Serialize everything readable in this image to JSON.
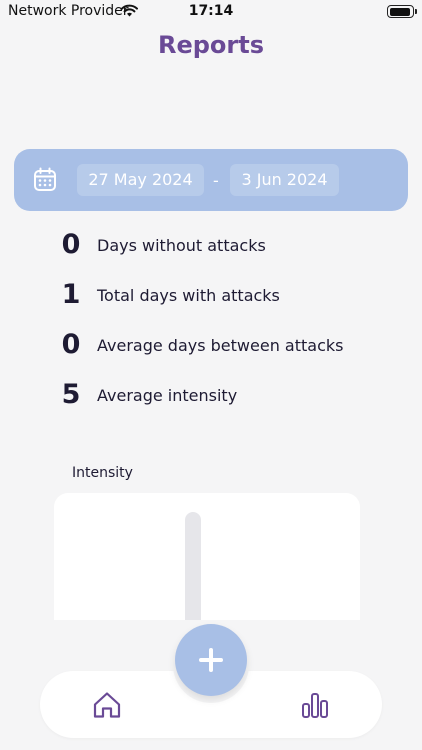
{
  "status_bar": {
    "carrier": "Network Provider",
    "time": "17:14"
  },
  "header": {
    "title": "Reports"
  },
  "date_range": {
    "start": "27 May 2024",
    "separator": "-",
    "end": "3 Jun 2024"
  },
  "stats": [
    {
      "value": "0",
      "label": "Days without attacks"
    },
    {
      "value": "1",
      "label": "Total days with attacks"
    },
    {
      "value": "0",
      "label": "Average days between attacks"
    },
    {
      "value": "5",
      "label": "Average intensity"
    }
  ],
  "intensity_section": {
    "label": "Intensity"
  },
  "nav": {
    "items": [
      {
        "icon": "home-icon"
      },
      {
        "icon": "bar-chart-icon"
      }
    ],
    "fab_icon": "plus-icon"
  },
  "colors": {
    "accent": "#a8bfe6",
    "title": "#6a4a96",
    "nav_icon": "#6a4a96",
    "text": "#1e1b33",
    "background": "#f5f5f6"
  }
}
